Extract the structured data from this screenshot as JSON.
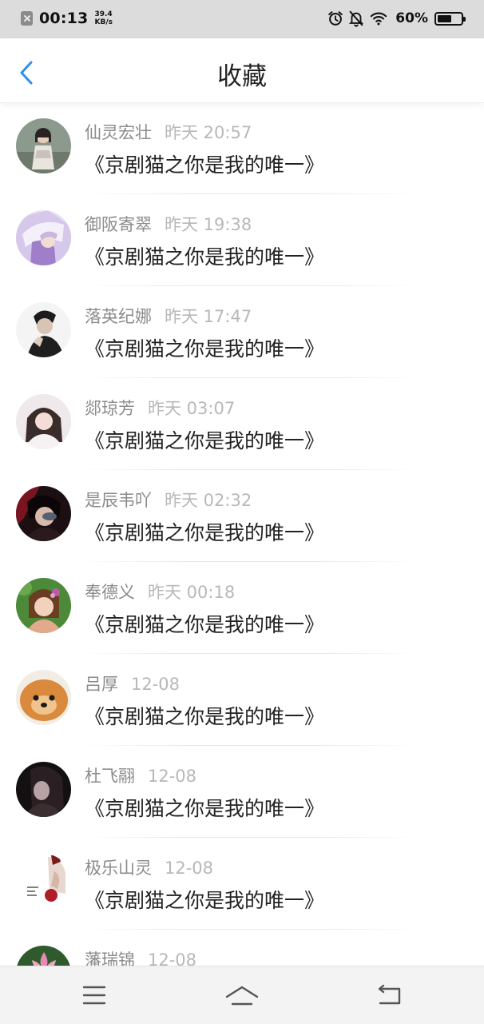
{
  "status_bar": {
    "time": "00:13",
    "net_speed_value": "39.4",
    "net_speed_unit": "KB/s",
    "battery_percent": "60%",
    "battery_level": 0.6,
    "icons": [
      "close-notification-icon",
      "alarm-clock-icon",
      "notifications-muted-icon",
      "wifi-icon",
      "battery-icon"
    ]
  },
  "nav": {
    "title": "收藏",
    "back_icon": "chevron-left-icon",
    "accent_color": "#2f8ff0"
  },
  "items": [
    {
      "name": "仙灵宏壮",
      "time": "昨天 20:57",
      "title": "《京剧猫之你是我的唯一》"
    },
    {
      "name": "御阪寄翠",
      "time": "昨天 19:38",
      "title": "《京剧猫之你是我的唯一》"
    },
    {
      "name": "落英纪娜",
      "time": "昨天 17:47",
      "title": "《京剧猫之你是我的唯一》"
    },
    {
      "name": "郯琼芳",
      "time": "昨天 03:07",
      "title": "《京剧猫之你是我的唯一》"
    },
    {
      "name": "是辰韦吖",
      "time": "昨天 02:32",
      "title": "《京剧猫之你是我的唯一》"
    },
    {
      "name": "奉德义",
      "time": "昨天 00:18",
      "title": "《京剧猫之你是我的唯一》"
    },
    {
      "name": "吕厚",
      "time": "12-08",
      "title": "《京剧猫之你是我的唯一》"
    },
    {
      "name": "杜飞翮",
      "time": "12-08",
      "title": "《京剧猫之你是我的唯一》"
    },
    {
      "name": "极乐山灵",
      "time": "12-08",
      "title": "《京剧猫之你是我的唯一》"
    },
    {
      "name": "藩瑞锦",
      "time": "12-08",
      "title": ""
    }
  ],
  "bottom_nav": {
    "icons": [
      "menu-icon",
      "home-icon",
      "back-icon"
    ]
  }
}
